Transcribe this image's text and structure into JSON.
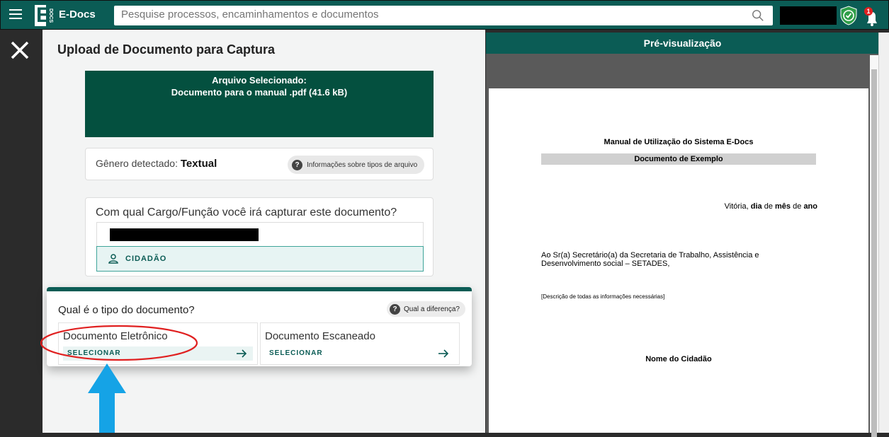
{
  "topbar": {
    "app_name": "E-Docs",
    "logo_letter": "E",
    "logo_vertical": "DOCS",
    "search_placeholder": "Pesquise processos, encaminhamentos e documentos",
    "notification_count": "1"
  },
  "main": {
    "title": "Upload de Documento para Captura",
    "file": {
      "heading": "Arquivo Selecionado:",
      "name": "Documento para o manual .pdf (41.6 kB)"
    },
    "genre": {
      "label": "Gênero detectado:",
      "value": "Textual",
      "info_button": "Informações sobre tipos de arquivo"
    },
    "role": {
      "question": "Com qual Cargo/Função você irá capturar este documento?",
      "option": "CIDADÃO"
    },
    "doctype": {
      "title": "Qual é o tipo do documento?",
      "diff_button": "Qual a diferença?",
      "options": [
        {
          "title": "Documento Eletrônico",
          "action": "SELECIONAR"
        },
        {
          "title": "Documento Escaneado",
          "action": "SELECIONAR"
        }
      ]
    }
  },
  "preview": {
    "header": "Pré-visualização",
    "doc": {
      "title": "Manual de Utilização do Sistema E-Docs",
      "subtitle": "Documento de Exemplo",
      "date_city": "Vitória,",
      "date_day": "dia",
      "date_de1": "de",
      "date_month": "mês",
      "date_de2": "de",
      "date_year": "ano",
      "address": "Ao Sr(a) Secretário(a) da Secretaria de Trabalho, Assistência e Desenvolvimento social – SETADES,",
      "description": "[Descrição de todas as informações necessárias]",
      "signature": "Nome do Cidadão"
    }
  },
  "colors": {
    "brand": "#0b5c55",
    "file_box": "#04503f",
    "annotation_red": "#e02020",
    "annotation_blue": "#15a3e6"
  }
}
